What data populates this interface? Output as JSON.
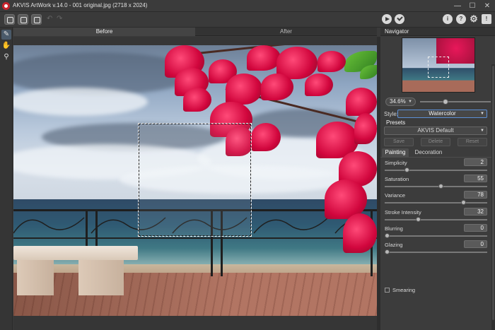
{
  "window": {
    "title": "AKVIS ArtWork v.14.0 - 001 original.jpg (2718 x 2024)",
    "minimize": "—",
    "maximize": "☐",
    "close": "✕"
  },
  "toolbar": {
    "help_label": "?",
    "info_label": "i",
    "settings_icon": "gear-icon",
    "gear_glyph": "⚙",
    "feedback_glyph": "!",
    "undo_glyph": "↶",
    "redo_glyph": "↷"
  },
  "tools": {
    "navigate_glyph": "✎",
    "hand_glyph": "✋",
    "zoom_glyph": "⚲"
  },
  "view_tabs": [
    {
      "label": "Before"
    },
    {
      "label": "After"
    }
  ],
  "navigator": {
    "title": "Navigator",
    "zoom_value": "34.6%",
    "zoom_level_fraction": 0.35
  },
  "style": {
    "label": "Style:",
    "value": "Watercolor"
  },
  "presets": {
    "label": "Presets",
    "value": "AKVIS Default",
    "buttons": {
      "save": "Save",
      "delete": "Delete",
      "reset": "Reset"
    }
  },
  "param_tabs": {
    "painting": "Painting",
    "decoration": "Decoration"
  },
  "params": [
    {
      "label": "Simplicity",
      "value": "2",
      "fraction": 0.2
    },
    {
      "label": "Saturation",
      "value": "55",
      "fraction": 0.55
    },
    {
      "label": "Variance",
      "value": "78",
      "fraction": 0.78
    },
    {
      "label": "Stroke Intensity",
      "value": "32",
      "fraction": 0.32
    },
    {
      "label": "Blurring",
      "value": "0",
      "fraction": 0.0
    },
    {
      "label": "Glazing",
      "value": "0",
      "fraction": 0.0
    }
  ],
  "smearing": {
    "label": "Smearing",
    "checked": false
  },
  "colors": {
    "accent": "#5c8fd6",
    "panel": "#3c3c3c",
    "logo": "#c8242c"
  }
}
